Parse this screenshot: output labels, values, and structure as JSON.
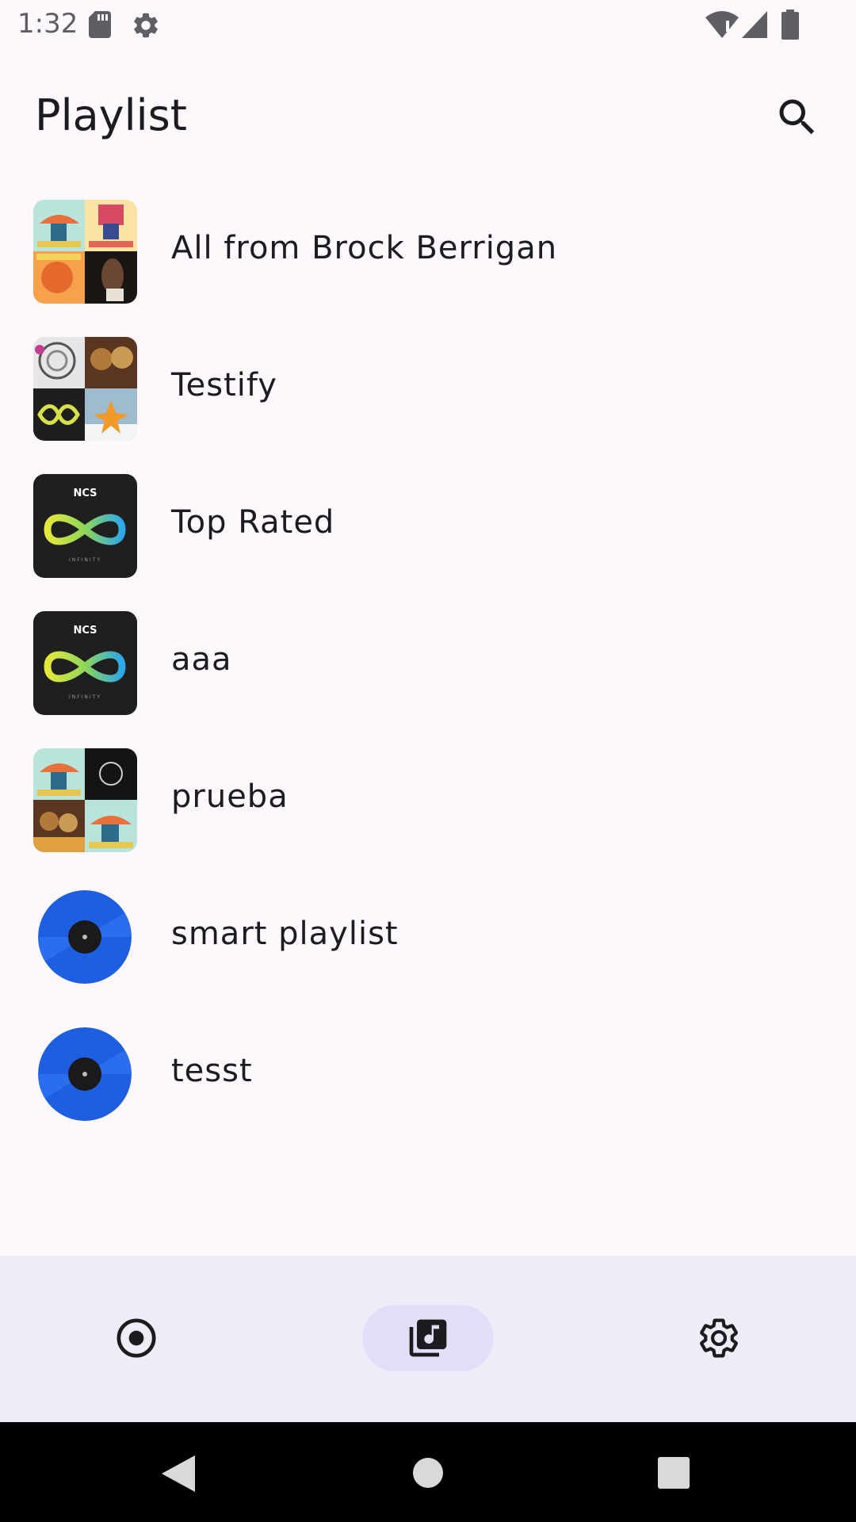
{
  "status_bar": {
    "time": "1:32",
    "icons": [
      "sd-card-icon",
      "settings-gear-icon",
      "wifi-icon",
      "cell-signal-icon",
      "battery-icon"
    ]
  },
  "header": {
    "title": "Playlist",
    "search_icon": "search-icon"
  },
  "playlists": [
    {
      "name": "All from Brock Berrigan",
      "thumbnail": "album-collage"
    },
    {
      "name": "Testify",
      "thumbnail": "album-collage"
    },
    {
      "name": "Top Rated",
      "thumbnail": "ncs-infinity-cover"
    },
    {
      "name": "aaa",
      "thumbnail": "ncs-infinity-cover"
    },
    {
      "name": "prueba",
      "thumbnail": "album-collage"
    },
    {
      "name": "smart playlist",
      "thumbnail": "vinyl-disc"
    },
    {
      "name": "tesst",
      "thumbnail": "vinyl-disc"
    }
  ],
  "cover_text": {
    "ncs": "NCS",
    "infinity": "INFINITY"
  },
  "bottom_nav": {
    "items": [
      {
        "icon": "now-playing-icon",
        "active": false
      },
      {
        "icon": "library-music-icon",
        "active": true
      },
      {
        "icon": "settings-icon",
        "active": false
      }
    ]
  },
  "system_nav": {
    "items": [
      "back-icon",
      "home-icon",
      "recents-icon"
    ]
  },
  "colors": {
    "background": "#fcf8fc",
    "nav_background": "#f0ecf7",
    "nav_active_pill": "#e0dff7",
    "disc_blue": "#1d5fe0",
    "text": "#1c1b1f"
  }
}
